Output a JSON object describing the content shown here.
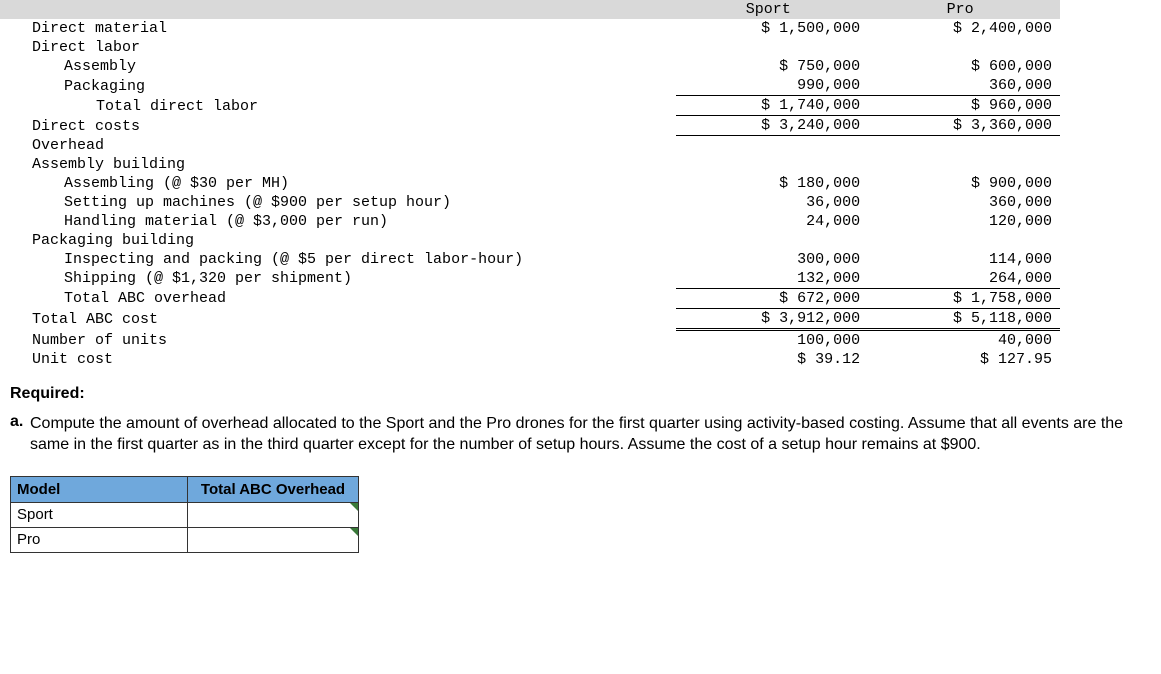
{
  "table": {
    "header_sport": "Sport",
    "header_pro": "Pro",
    "rows": {
      "dm": {
        "label": "Direct material",
        "sport": "$ 1,500,000",
        "pro": "$ 2,400,000"
      },
      "dl": {
        "label": "Direct labor"
      },
      "asm": {
        "label": "Assembly",
        "sport": "$ 750,000",
        "pro": "$ 600,000"
      },
      "pkg": {
        "label": "Packaging",
        "sport": "990,000",
        "pro": "360,000"
      },
      "tdl": {
        "label": "Total direct labor",
        "sport": "$ 1,740,000",
        "pro": "$ 960,000"
      },
      "dc": {
        "label": "Direct costs",
        "sport": "$ 3,240,000",
        "pro": "$ 3,360,000"
      },
      "oh": {
        "label": "Overhead"
      },
      "ab": {
        "label": "Assembly building"
      },
      "assem": {
        "label": "Assembling (@ $30 per MH)",
        "sport": "$ 180,000",
        "pro": "$ 900,000"
      },
      "setup": {
        "label": "Setting up machines (@ $900 per setup hour)",
        "sport": "36,000",
        "pro": "360,000"
      },
      "hand": {
        "label": "Handling material (@ $3,000 per run)",
        "sport": "24,000",
        "pro": "120,000"
      },
      "pb": {
        "label": "Packaging building"
      },
      "insp": {
        "label": "Inspecting and packing (@ $5 per direct labor-hour)",
        "sport": "300,000",
        "pro": "114,000"
      },
      "ship": {
        "label": "Shipping (@ $1,320 per shipment)",
        "sport": "132,000",
        "pro": "264,000"
      },
      "tabco": {
        "label": "Total ABC overhead",
        "sport": "$ 672,000",
        "pro": "$ 1,758,000"
      },
      "tabcc": {
        "label": "Total ABC cost",
        "sport": "$ 3,912,000",
        "pro": "$ 5,118,000"
      },
      "units": {
        "label": "Number of units",
        "sport": "100,000",
        "pro": "40,000"
      },
      "unitcost": {
        "label": "Unit cost",
        "sport": "$ 39.12",
        "pro": "$ 127.95"
      }
    }
  },
  "required_label": "Required:",
  "question_marker": "a.",
  "question_text": "Compute the amount of overhead allocated to the Sport and the Pro drones for the first quarter using activity-based costing. Assume that all events are the same in the first quarter as in the third quarter except for the number of setup hours. Assume the cost of a setup hour remains at $900.",
  "answer_table": {
    "col_model": "Model",
    "col_total": "Total ABC Overhead",
    "row_sport": "Sport",
    "row_pro": "Pro"
  }
}
